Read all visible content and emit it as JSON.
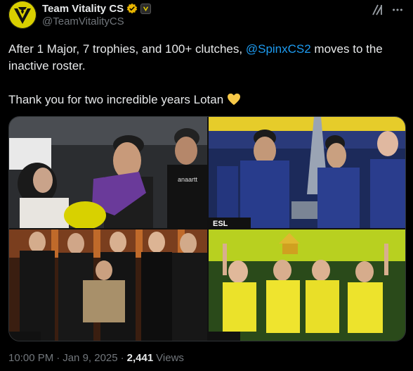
{
  "author": {
    "display_name": "Team Vitality CS",
    "handle": "@TeamVitalityCS",
    "avatar_icon": "team-vitality-logo",
    "verified": true,
    "affiliate_badge": "vitality-badge"
  },
  "post": {
    "line1_before": "After 1 Major, 7 trophies, and 100+ clutches, ",
    "mention": "@SpinxCS2",
    "line1_after": " moves to the inactive roster.",
    "line2": "Thank you for two incredible years Lotan",
    "emoji": "yellow-heart"
  },
  "media": {
    "count": 4,
    "images": [
      {
        "name": "celebration-crowd-photo"
      },
      {
        "name": "trophy-lift-photo"
      },
      {
        "name": "formal-team-photo"
      },
      {
        "name": "stage-celebration-photo"
      }
    ]
  },
  "meta": {
    "time": "10:00 PM",
    "sep1": "·",
    "date": "Jan 9, 2025",
    "sep2": "·",
    "views_count": "2,441",
    "views_label": "Views"
  },
  "colors": {
    "background": "#000000",
    "text": "#e7e9ea",
    "secondary": "#71767b",
    "link": "#1d9bf0",
    "brand_yellow": "#f5e400",
    "verified_gold": "#e8b500"
  }
}
